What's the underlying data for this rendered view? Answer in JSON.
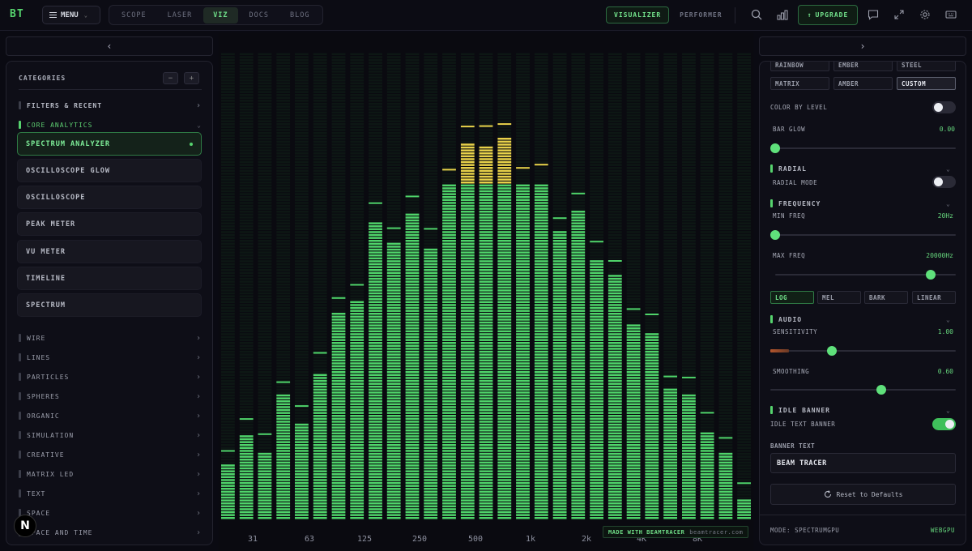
{
  "topbar": {
    "logo": "BT",
    "menu_label": "MENU",
    "nav_tabs": [
      {
        "label": "SCOPE",
        "active": false
      },
      {
        "label": "LASER",
        "active": false
      },
      {
        "label": "VIZ",
        "active": true
      },
      {
        "label": "DOCS",
        "active": false
      },
      {
        "label": "BLOG",
        "active": false
      }
    ],
    "modes": [
      {
        "label": "VISUALIZER",
        "active": true
      },
      {
        "label": "PERFORMER",
        "active": false
      }
    ],
    "upgrade_label": "UPGRADE",
    "icons": [
      "search-icon",
      "bar-chart-icon",
      "chat-icon",
      "fullscreen-icon",
      "gear-icon",
      "keyboard-icon"
    ]
  },
  "left_panel": {
    "collapse_icon": "chevron-left-icon",
    "title": "CATEGORIES",
    "collapse_all": "−",
    "expand_all": "+",
    "filters_label": "FILTERS & RECENT",
    "open_category": "CORE ANALYTICS",
    "visualizers": [
      {
        "label": "SPECTRUM ANALYZER",
        "active": true
      },
      {
        "label": "OSCILLOSCOPE GLOW",
        "active": false
      },
      {
        "label": "OSCILLOSCOPE",
        "active": false
      },
      {
        "label": "PEAK METER",
        "active": false
      },
      {
        "label": "VU METER",
        "active": false
      },
      {
        "label": "TIMELINE",
        "active": false
      },
      {
        "label": "SPECTRUM",
        "active": false
      }
    ],
    "categories": [
      "WIRE",
      "LINES",
      "PARTICLES",
      "SPHERES",
      "ORGANIC",
      "SIMULATION",
      "CREATIVE",
      "MATRIX LED",
      "TEXT",
      "SPACE",
      "SPACE AND TIME"
    ],
    "badge": "N"
  },
  "visualizer": {
    "freq_labels": [
      "31",
      "63",
      "125",
      "250",
      "500",
      "1k",
      "2k",
      "4K",
      "8K"
    ],
    "made_with": "MADE WITH BEAMTRACER",
    "made_with_url": "beamtracer.com",
    "colors": {
      "bar": "#4fd46a",
      "peak": "#e8d24a",
      "dim": "#13301c"
    }
  },
  "chart_data": {
    "type": "bar",
    "xlabel": "",
    "ylabel": "",
    "categories": [
      "31",
      "63",
      "125",
      "250",
      "500",
      "1k",
      "2k",
      "4K",
      "8K"
    ],
    "values": [
      0.18,
      0.32,
      0.66,
      0.68,
      0.9,
      0.75,
      0.63,
      0.39,
      0.21
    ],
    "ylim": [
      0,
      1
    ],
    "peak_color": "#e8d24a",
    "bar_color": "#4fd46a"
  },
  "right_panel": {
    "collapse_icon": "chevron-right-icon",
    "palettes": [
      {
        "label": "RAINBOW",
        "active": false
      },
      {
        "label": "EMBER",
        "active": false
      },
      {
        "label": "STEEL",
        "active": false
      },
      {
        "label": "MATRIX",
        "active": false
      },
      {
        "label": "AMBER",
        "active": false
      },
      {
        "label": "CUSTOM",
        "active": true
      }
    ],
    "color_by_level_label": "COLOR BY LEVEL",
    "color_by_level": false,
    "bar_glow_label": "BAR GLOW",
    "bar_glow_value": "0.00",
    "bar_glow": 0.0,
    "radial_title": "RADIAL",
    "radial_mode_label": "RADIAL MODE",
    "radial_mode": false,
    "frequency_title": "FREQUENCY",
    "min_freq_label": "MIN FREQ",
    "min_freq_value": "20Hz",
    "min_freq": 0.0,
    "max_freq_label": "MAX FREQ",
    "max_freq_value": "20000Hz",
    "max_freq": 0.86,
    "scales": [
      {
        "label": "LOG",
        "active": true
      },
      {
        "label": "MEL",
        "active": false
      },
      {
        "label": "BARK",
        "active": false
      },
      {
        "label": "LINEAR",
        "active": false
      }
    ],
    "audio_title": "AUDIO",
    "sensitivity_label": "SENSITIVITY",
    "sensitivity_value": "1.00",
    "sensitivity": 0.33,
    "sensitivity_meter": 0.1,
    "smoothing_label": "SMOOTHING",
    "smoothing_value": "0.60",
    "smoothing": 0.6,
    "idle_title": "IDLE BANNER",
    "idle_text_label": "IDLE TEXT BANNER",
    "idle_text": true,
    "banner_text_label": "BANNER TEXT",
    "banner_text": "BEAM TRACER",
    "reset_label": "Reset to Defaults",
    "mode_status": "MODE: SPECTRUMGPU",
    "renderer": "WEBGPU"
  }
}
